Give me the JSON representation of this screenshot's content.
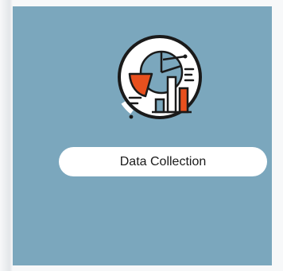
{
  "tile": {
    "label": "Data Collection",
    "icon": "data-analytics-icon"
  },
  "colors": {
    "tile_background": "#7ba7bd",
    "label_background": "#ffffff",
    "icon_accent": "#e8501e",
    "icon_secondary": "#7ba7bd",
    "icon_outline": "#1a1a1a"
  }
}
